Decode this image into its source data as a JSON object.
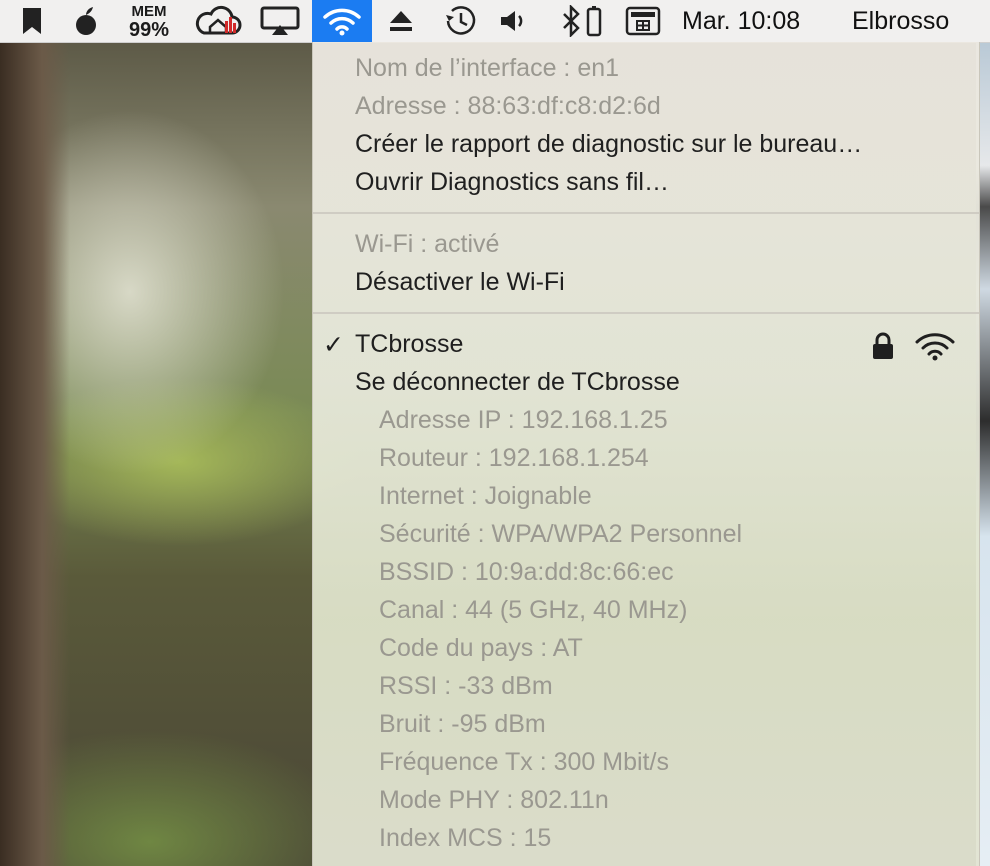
{
  "menubar": {
    "mem_label": "MEM",
    "mem_value": "99%",
    "clock": "Mar. 10:08",
    "user": "Elbrosso",
    "accent_color": "#1b7cf2",
    "icons": [
      "bookmark-icon",
      "apple-icon",
      "memory-monitor-icon",
      "home-cloud-icon",
      "airplay-icon",
      "wifi-icon",
      "eject-icon",
      "time-machine-icon",
      "volume-icon",
      "bluetooth-icon",
      "keyboard-icon"
    ]
  },
  "wifi_menu": {
    "interface_name": "Nom de l’interface : en1",
    "address": "Adresse : 88:63:df:c8:d2:6d",
    "create_report": "Créer le rapport de diagnostic sur le bureau…",
    "open_diagnostics": "Ouvrir Diagnostics sans fil…",
    "wifi_status": "Wi-Fi : activé",
    "disable_wifi": "Désactiver le Wi-Fi",
    "network": {
      "checkmark": "✓",
      "name": "TCbrosse",
      "disconnect": "Se déconnecter de TCbrosse",
      "details": [
        "Adresse IP : 192.168.1.25",
        "Routeur : 192.168.1.254",
        "Internet : Joignable",
        "Sécurité : WPA/WPA2 Personnel",
        "BSSID : 10:9a:dd:8c:66:ec",
        "Canal : 44 (5 GHz, 40 MHz)",
        "Code du pays : AT",
        "RSSI : -33 dBm",
        "Bruit : -95 dBm",
        "Fréquence Tx : 300 Mbit/s",
        "Mode PHY : 802.11n",
        "Index MCS : 15"
      ]
    }
  }
}
